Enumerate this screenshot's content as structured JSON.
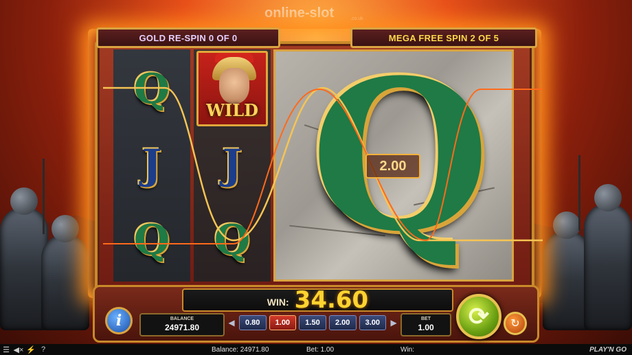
{
  "watermark": {
    "brand": "online-slot",
    "suffix": ".co.uk"
  },
  "header": {
    "gold_respin": "GOLD RE-SPIN 0 OF 0",
    "mega_free_spin": "MEGA FREE SPIN 2 OF 5"
  },
  "reels": {
    "reel1": [
      "Q",
      "J",
      "Q"
    ],
    "reel2": [
      "WILD",
      "J",
      "Q"
    ],
    "mega_symbol": "Q",
    "wild_label": "WILD"
  },
  "mega_win_badge": "2.00",
  "console": {
    "win_label": "WIN:",
    "win_value": "34.60",
    "balance_label": "BALANCE",
    "balance_value": "24971.80",
    "bet_label": "BET",
    "bet_value": "1.00",
    "bet_options": [
      "0.80",
      "1.00",
      "1.50",
      "2.00",
      "3.00"
    ],
    "selected_bet": "1.00",
    "info_glyph": "i"
  },
  "status_bar": {
    "balance": "Balance: 24971.80",
    "bet": "Bet: 1.00",
    "win": "Win:",
    "brand": "PLAY'N GO"
  },
  "colors": {
    "payline_gold": "#f6c453",
    "payline_orange": "#ff6a1a",
    "win_value": "#ffd330",
    "spin_button": "#8ac21e"
  },
  "icons": [
    "menu-icon",
    "sound-icon",
    "turbo-icon",
    "info-icon",
    "spin-icon",
    "autoplay-icon"
  ]
}
